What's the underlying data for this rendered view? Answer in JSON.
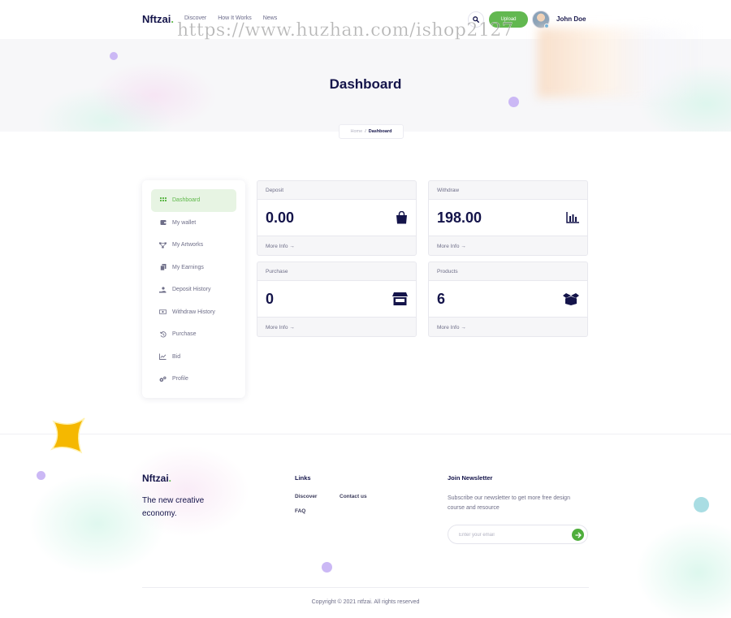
{
  "header": {
    "logo_text": "Nftzai",
    "logo_dot": ".",
    "nav": [
      "Discover",
      "How It Works",
      "News"
    ],
    "upload_label": "Upload",
    "user_name": "John Doe",
    "watermark": "https://www.huzhan.com/ishop2127"
  },
  "hero": {
    "title": "Dashboard",
    "breadcrumb": {
      "home": "Home",
      "separator": "/",
      "current": "Dashboard"
    }
  },
  "sidebar": {
    "items": [
      {
        "label": "Dashboard",
        "icon": "grid-icon",
        "active": true
      },
      {
        "label": "My wallet",
        "icon": "wallet-icon"
      },
      {
        "label": "My Artworks",
        "icon": "nodes-icon"
      },
      {
        "label": "My Earnings",
        "icon": "files-icon"
      },
      {
        "label": "Deposit History",
        "icon": "hand-coin-icon"
      },
      {
        "label": "Withdraw History",
        "icon": "money-bill-icon"
      },
      {
        "label": "Purchase",
        "icon": "history-icon"
      },
      {
        "label": "Bid",
        "icon": "line-chart-icon"
      },
      {
        "label": "Profile",
        "icon": "cogs-icon"
      }
    ]
  },
  "cards": [
    {
      "title": "Deposit",
      "value": "0.00",
      "more": "More Info",
      "icon": "shopping-bag-icon"
    },
    {
      "title": "Withdraw",
      "value": "198.00",
      "more": "More Info",
      "icon": "bar-chart-icon"
    },
    {
      "title": "Purchase",
      "value": "0",
      "more": "More Info",
      "icon": "store-icon"
    },
    {
      "title": "Products",
      "value": "6",
      "more": "More Info",
      "icon": "box-open-icon"
    }
  ],
  "footer": {
    "logo_text": "Nftzai",
    "logo_dot": ".",
    "tagline": "The new creative economy.",
    "links_heading": "Links",
    "links": [
      "Discover",
      "Contact us",
      "FAQ"
    ],
    "newsletter_heading": "Join Newsletter",
    "newsletter_desc": "Subscribe our newsletter to get more free design course and resource",
    "email_placeholder": "Enter your email",
    "copyright": "Copyright © 2021 ntfzai. All rights reserved"
  },
  "colors": {
    "brand_green": "#5fb84a",
    "navy": "#14144a",
    "star_yellow": "#f5b800",
    "bubble_purple": "#cbb8f5",
    "bubble_teal": "#a9dde3"
  }
}
